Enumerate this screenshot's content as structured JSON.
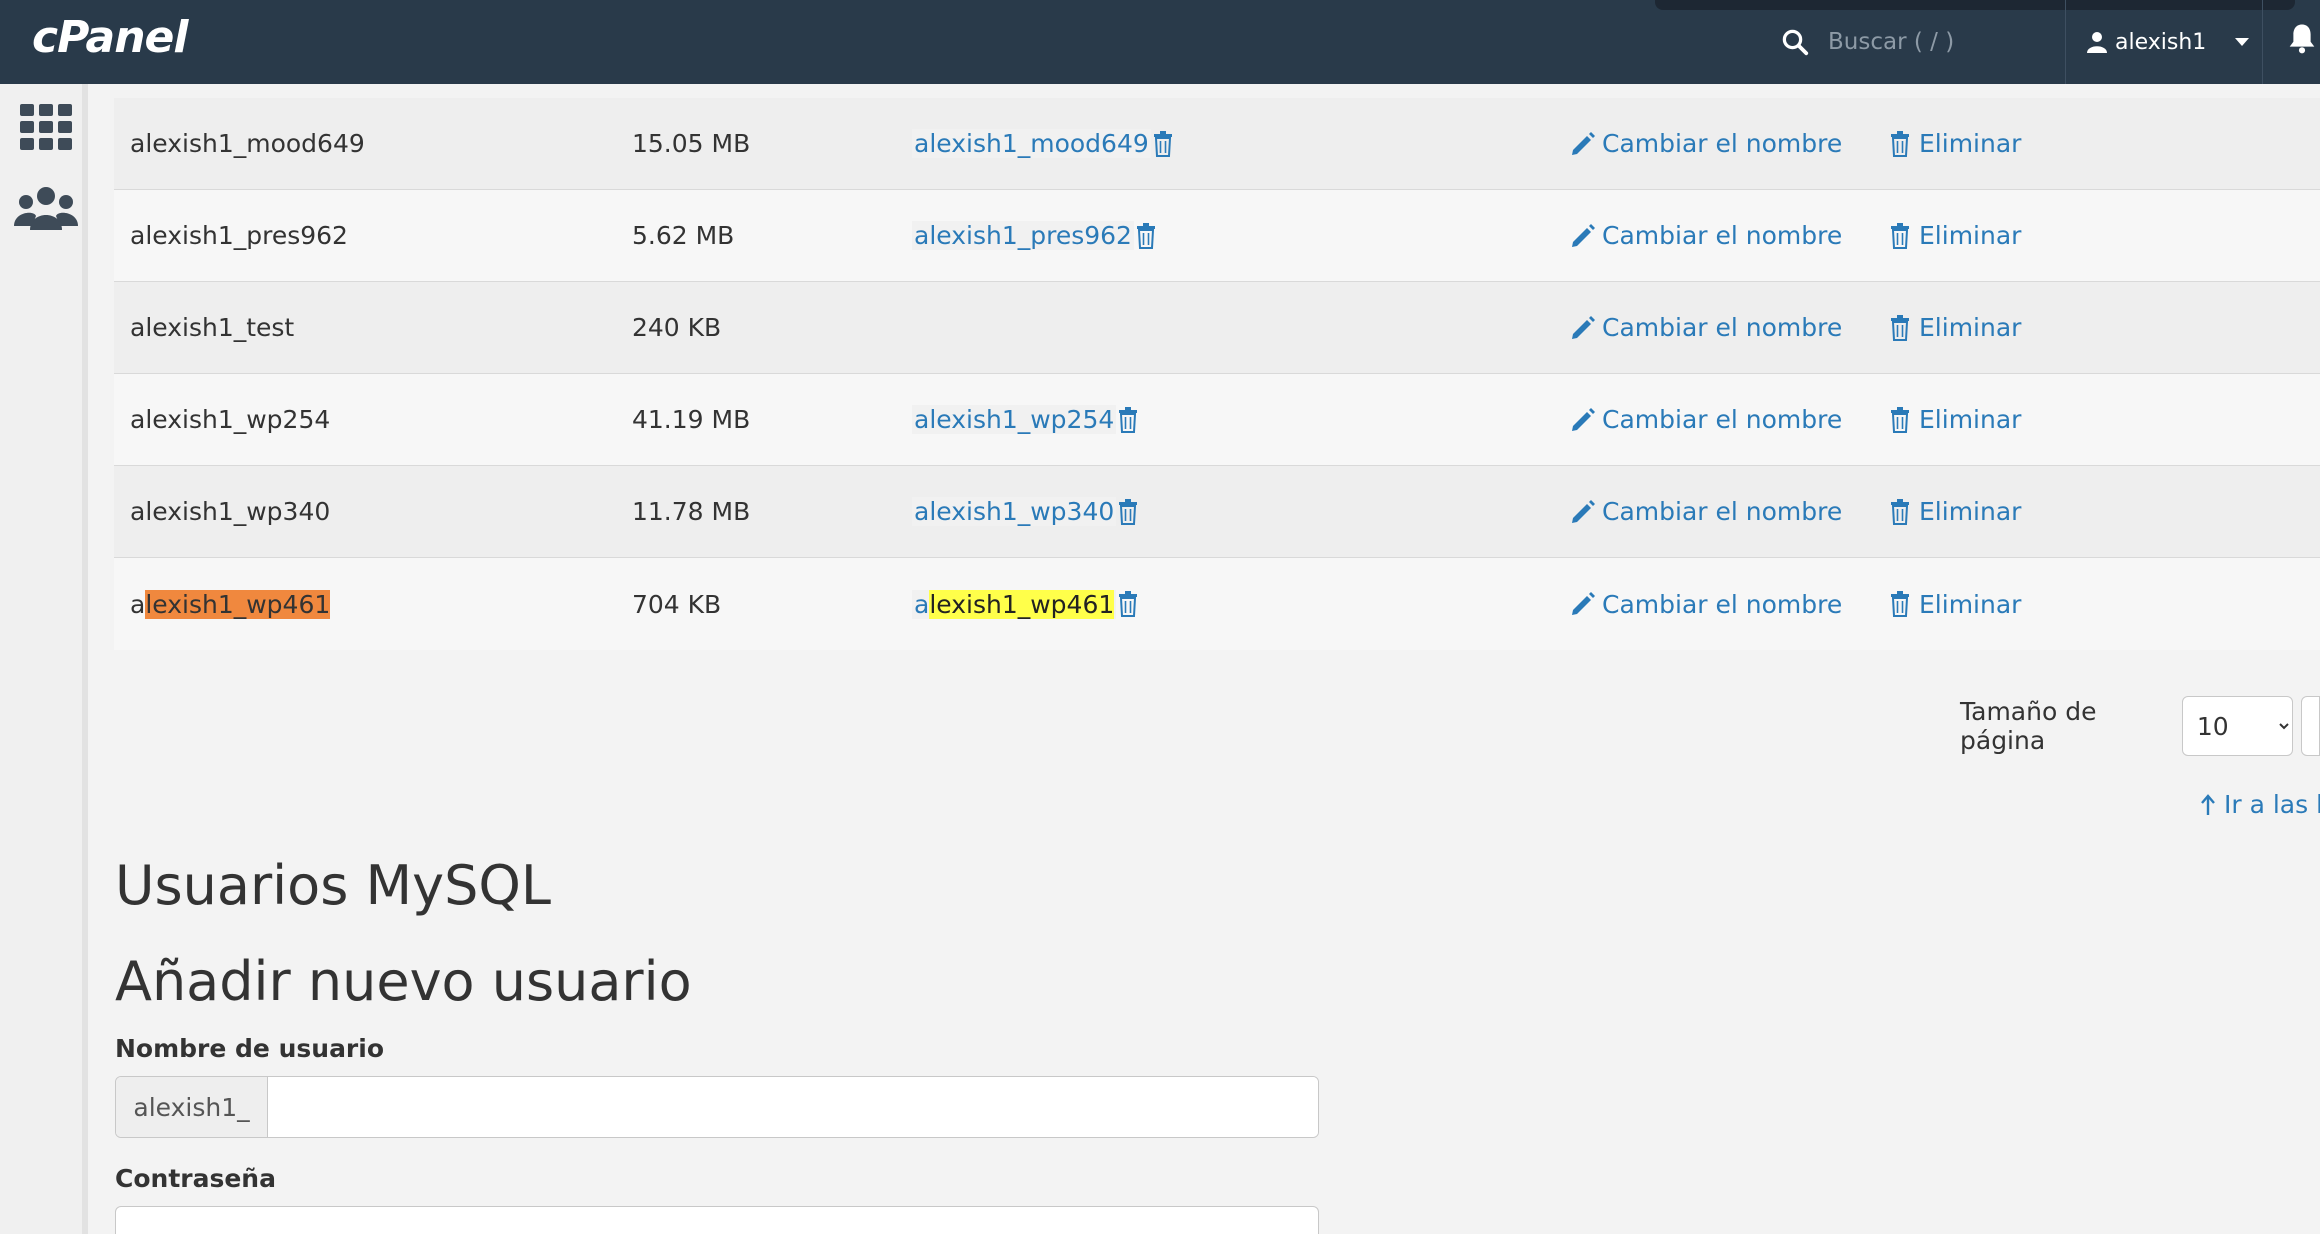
{
  "header": {
    "logo": "cPanel",
    "search_placeholder": "Buscar ( / )",
    "username": "alexish1"
  },
  "icons": {
    "search": "search-icon",
    "user": "user-icon",
    "caret": "caret-down-icon",
    "bell": "bell-icon",
    "apps": "grid-icon",
    "users": "users-icon",
    "trash": "trash-icon",
    "pencil": "pencil-icon"
  },
  "colors": {
    "topbar": "#293a4a",
    "link": "#2a7ab8",
    "highlight_orange": "#f0883e",
    "highlight_yellow": "#ffff4a"
  },
  "databases": {
    "rows": [
      {
        "name": "alexish1_mood649",
        "size": "15.05 MB",
        "user": "alexish1_mood649",
        "rename": "Cambiar el nombre",
        "delete": "Eliminar"
      },
      {
        "name": "alexish1_pres962",
        "size": "5.62 MB",
        "user": "alexish1_pres962",
        "rename": "Cambiar el nombre",
        "delete": "Eliminar"
      },
      {
        "name": "alexish1_test",
        "size": "240 KB",
        "user": "",
        "rename": "Cambiar el nombre",
        "delete": "Eliminar"
      },
      {
        "name": "alexish1_wp254",
        "size": "41.19 MB",
        "user": "alexish1_wp254",
        "rename": "Cambiar el nombre",
        "delete": "Eliminar"
      },
      {
        "name": "alexish1_wp340",
        "size": "11.78 MB",
        "user": "alexish1_wp340",
        "rename": "Cambiar el nombre",
        "delete": "Eliminar"
      },
      {
        "name_prefix": "a",
        "name_highlight": "lexish1_wp461",
        "size": "704 KB",
        "user_prefix": "a",
        "user_highlight": "lexish1_wp461",
        "rename": "Cambiar el nombre",
        "delete": "Eliminar"
      }
    ]
  },
  "pagination": {
    "label": "Tamaño de página",
    "page_size": "10",
    "back_to_top": "Ir a las b"
  },
  "mysql_users": {
    "title": "Usuarios MySQL",
    "add_title": "Añadir nuevo usuario",
    "username_label": "Nombre de usuario",
    "username_prefix": "alexish1_",
    "username_value": "",
    "password_label": "Contraseña"
  }
}
